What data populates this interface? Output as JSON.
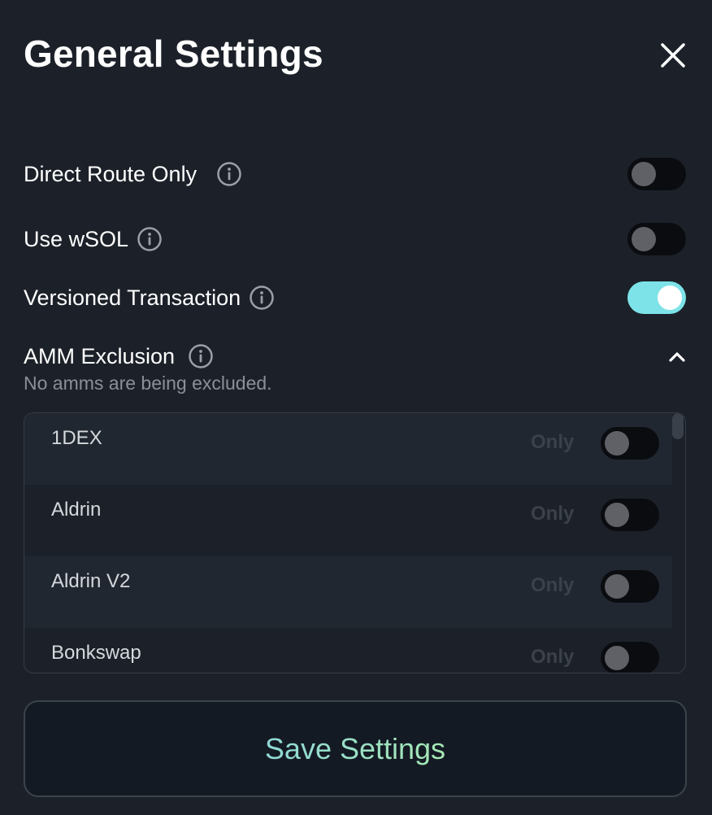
{
  "header": {
    "title": "General Settings"
  },
  "settings": [
    {
      "label": "Direct Route Only",
      "on": false
    },
    {
      "label": "Use wSOL",
      "on": false
    },
    {
      "label": "Versioned Transaction",
      "on": true
    }
  ],
  "amm_exclusion": {
    "label": "AMM Exclusion",
    "subtitle": "No amms are being excluded.",
    "expanded": true,
    "items": [
      {
        "name": "1DEX",
        "only_label": "Only",
        "on": false
      },
      {
        "name": "Aldrin",
        "only_label": "Only",
        "on": false
      },
      {
        "name": "Aldrin V2",
        "only_label": "Only",
        "on": false
      },
      {
        "name": "Bonkswap",
        "only_label": "Only",
        "on": false
      }
    ]
  },
  "footer": {
    "save_label": "Save Settings"
  },
  "colors": {
    "background": "#1c2129",
    "toggle_on": "#7de3e8",
    "toggle_off": "#0a0c10",
    "save_gradient_start": "#8fd8d6",
    "save_gradient_end": "#a6e8b4"
  },
  "icons": {
    "close": "close-icon",
    "info": "info-icon",
    "chevron": "chevron-up-icon"
  }
}
